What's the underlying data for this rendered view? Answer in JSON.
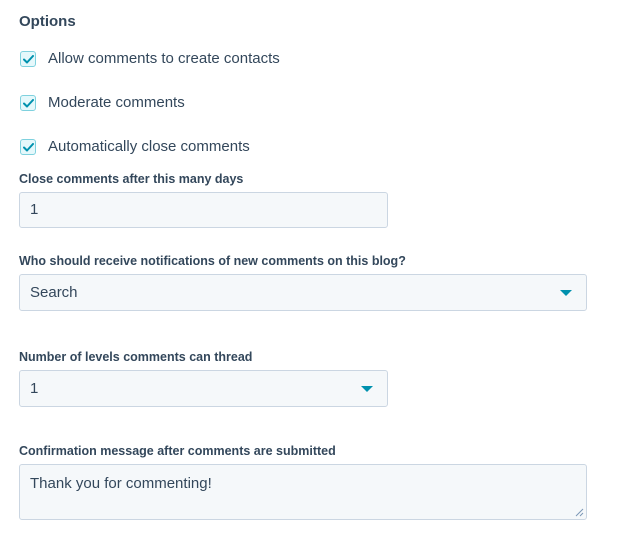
{
  "options": {
    "title": "Options",
    "checkboxes": [
      {
        "label": "Allow comments to create contacts",
        "checked": true
      },
      {
        "label": "Moderate comments",
        "checked": true
      },
      {
        "label": "Automatically close comments",
        "checked": true
      }
    ]
  },
  "close_days": {
    "label": "Close comments after this many days",
    "value": "1"
  },
  "notifications": {
    "label": "Who should receive notifications of new comments on this blog?",
    "placeholder": "Search"
  },
  "thread_levels": {
    "label": "Number of levels comments can thread",
    "value": "1"
  },
  "confirmation": {
    "label": "Confirmation message after comments are submitted",
    "value": "Thank you for commenting!"
  },
  "colors": {
    "text": "#33475b",
    "accent": "#0091ae",
    "input_bg": "#f5f8fa",
    "input_border": "#cbd6e2"
  },
  "icons": {
    "checkbox": "check-icon",
    "dropdown": "caret-down-icon",
    "resize": "resize-handle-icon"
  }
}
